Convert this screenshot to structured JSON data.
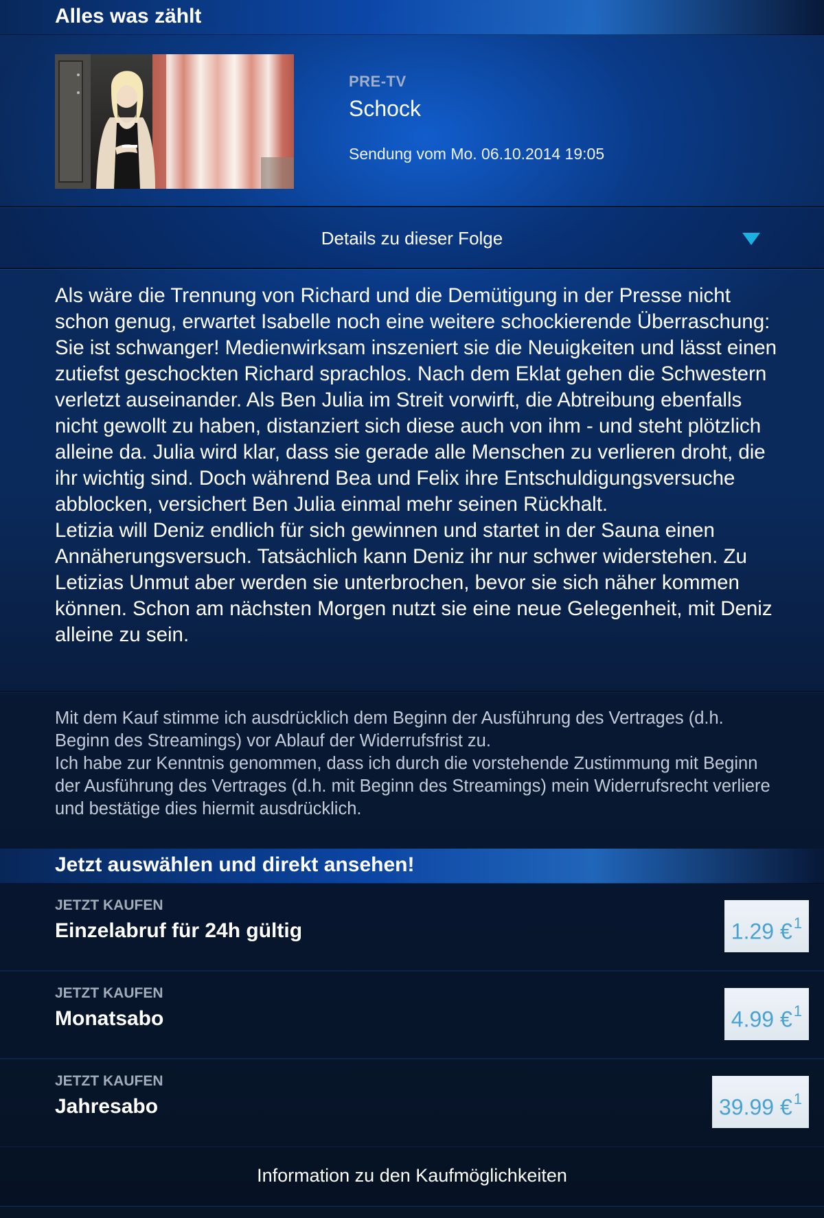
{
  "header": {
    "title": "Alles was zählt"
  },
  "episode": {
    "category": "PRE-TV",
    "title": "Schock",
    "air_date": "Sendung vom Mo. 06.10.2014 19:05"
  },
  "details": {
    "label": "Details zu dieser Folge",
    "expanded": true,
    "icon": "triangle-down-icon",
    "synopsis": "Als wäre die Trennung von Richard und die Demütigung in der Presse nicht schon genug, erwartet Isabelle noch eine weitere schockierende Überraschung: Sie ist schwanger! Medienwirksam inszeniert sie die Neuigkeiten und lässt einen zutiefst geschockten Richard sprachlos. Nach dem Eklat gehen die Schwestern verletzt auseinander. Als Ben Julia im Streit vorwirft, die Abtreibung ebenfalls nicht gewollt zu haben, distanziert sich diese auch von ihm - und steht plötzlich alleine da. Julia wird klar, dass sie gerade alle Menschen zu verlieren droht, die ihr wichtig sind. Doch während Bea und Felix ihre Entschuldigungsversuche abblocken, versichert Ben Julia einmal mehr seinen Rückhalt.\nLetizia will Deniz endlich für sich gewinnen und startet in der Sauna einen Annäherungsversuch. Tatsächlich kann Deniz ihr nur schwer widerstehen. Zu Letizias Unmut aber werden sie unterbrochen, bevor sie sich näher kommen können. Schon am nächsten Morgen nutzt sie eine neue Gelegenheit, mit Deniz alleine zu sein."
  },
  "legal": {
    "text": "Mit dem Kauf stimme ich ausdrücklich dem Beginn der Ausführung des Vertrages (d.h. Beginn des Streamings) vor Ablauf der Widerrufsfrist zu.\nIch habe zur Kenntnis genommen, dass ich durch die vorstehende Zustimmung mit Beginn der Ausführung des Vertrages (d.h. mit Beginn des Streamings) mein Widerrufsrecht verliere und bestätige dies hiermit ausdrücklich."
  },
  "offers": {
    "title": "Jetzt auswählen und direkt ansehen!",
    "items": [
      {
        "kicker": "JETZT KAUFEN",
        "name": "Einzelabruf für 24h gültig",
        "price": "1.29 €",
        "footnote": "1"
      },
      {
        "kicker": "JETZT KAUFEN",
        "name": "Monatsabo",
        "price": "4.99 €",
        "footnote": "1"
      },
      {
        "kicker": "JETZT KAUFEN",
        "name": "Jahresabo",
        "price": "39.99 €",
        "footnote": "1"
      }
    ]
  },
  "info": {
    "label": "Information zu den Kaufmöglichkeiten"
  },
  "colors": {
    "accent": "#1ab0e0",
    "price_text": "#4aa2d3",
    "background": "#0a2d64"
  }
}
